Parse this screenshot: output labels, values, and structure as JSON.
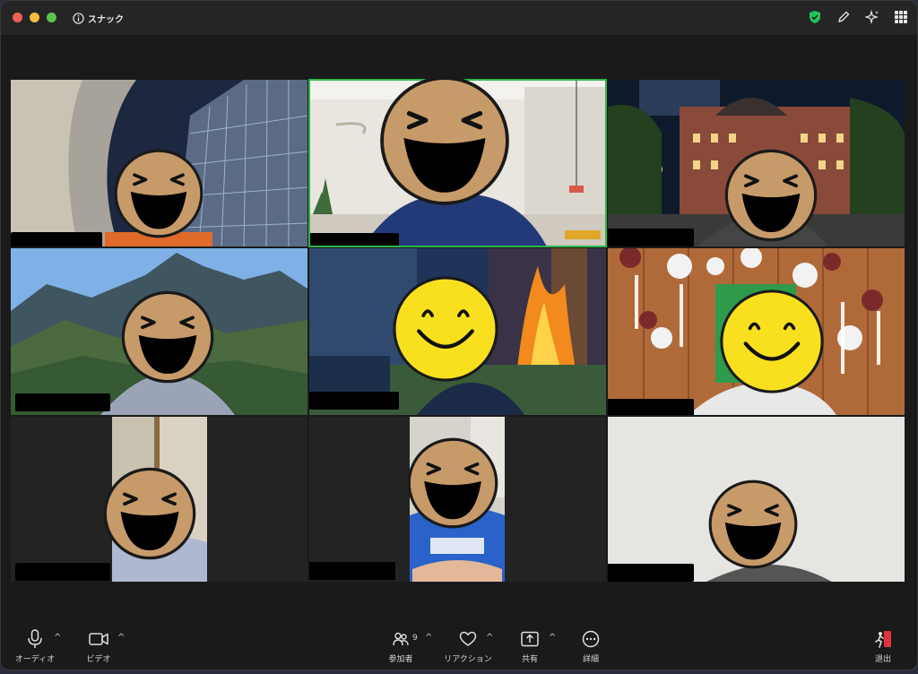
{
  "window": {
    "title": "スナック"
  },
  "toolbar": {
    "audio_label": "オーディオ",
    "video_label": "ビデオ",
    "participants_label": "参加者",
    "participants_count": "9",
    "reactions_label": "リアクション",
    "share_label": "共有",
    "more_label": "詳細",
    "leave_label": "退出"
  },
  "colors": {
    "active_speaker_border": "#2fb54a",
    "leave_red": "#e0333c",
    "security_green": "#22c55e"
  }
}
